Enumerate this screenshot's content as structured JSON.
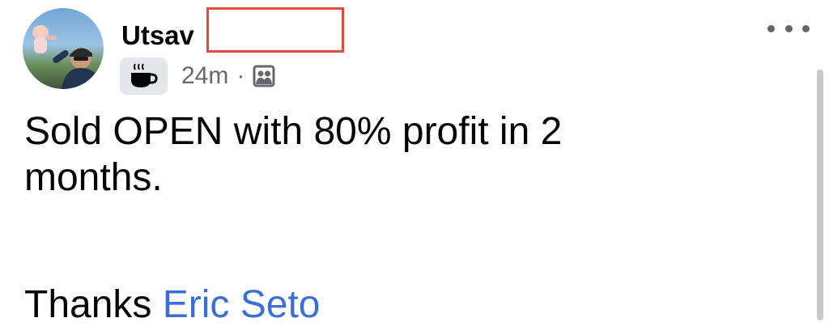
{
  "post": {
    "author_name": "Utsav",
    "timestamp": "24m",
    "separator": "·",
    "text_line_1": "Sold OPEN with 80% profit in 2",
    "text_line_2": "months.",
    "thanks_text": "Thanks ",
    "mention": "Eric Seto"
  },
  "icons": {
    "feeling": "coffee-cup-icon",
    "audience": "friends-audience-icon",
    "more": "more-options-icon"
  },
  "colors": {
    "name": "#050505",
    "meta": "#65676b",
    "mention_link": "#3b6fd6",
    "redaction_border": "#e34a3a",
    "badge_bg": "#e4e6eb"
  }
}
